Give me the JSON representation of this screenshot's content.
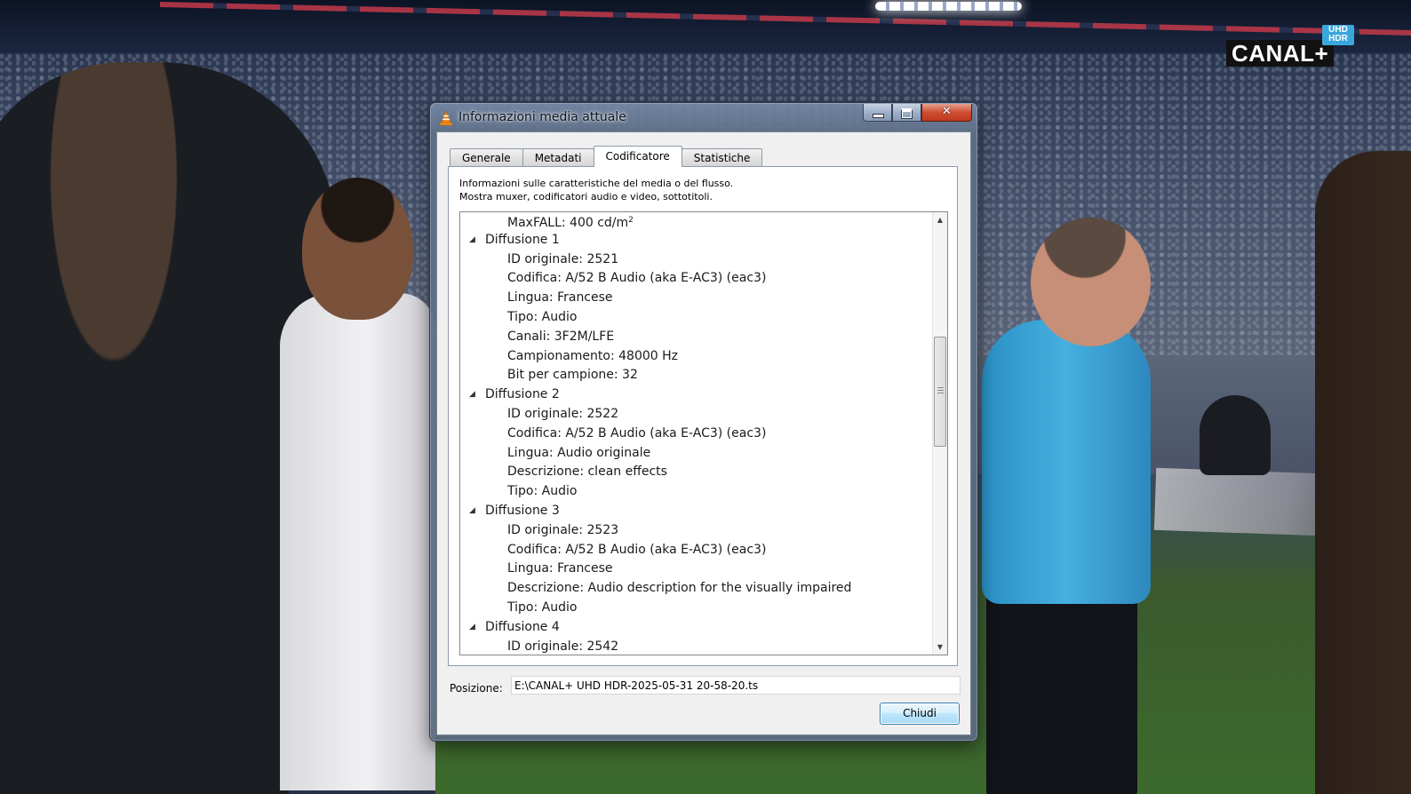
{
  "overlay": {
    "channel_logo": "CANAL+",
    "channel_tag": "UHD HDR"
  },
  "dialog": {
    "title": "Informazioni media attuale",
    "window_buttons": {
      "close_glyph": "✕"
    },
    "tabs": [
      {
        "label": "Generale",
        "active": false
      },
      {
        "label": "Metadati",
        "active": false
      },
      {
        "label": "Codificatore",
        "active": true
      },
      {
        "label": "Statistiche",
        "active": false
      }
    ],
    "description_line1": "Informazioni sulle caratteristiche del media o del flusso.",
    "description_line2": "Mostra muxer, codificatori audio e video, sottotitoli.",
    "tree": [
      {
        "level": 1,
        "text": "MaxFALL: 400 cd/m",
        "sup": "2"
      },
      {
        "level": 0,
        "text": "Diffusione 1"
      },
      {
        "level": 1,
        "text": "ID originale: 2521"
      },
      {
        "level": 1,
        "text": "Codifica: A/52 B Audio (aka E-AC3) (eac3)"
      },
      {
        "level": 1,
        "text": "Lingua: Francese"
      },
      {
        "level": 1,
        "text": "Tipo: Audio"
      },
      {
        "level": 1,
        "text": "Canali: 3F2M/LFE"
      },
      {
        "level": 1,
        "text": "Campionamento: 48000 Hz"
      },
      {
        "level": 1,
        "text": "Bit per campione: 32"
      },
      {
        "level": 0,
        "text": "Diffusione 2"
      },
      {
        "level": 1,
        "text": "ID originale: 2522"
      },
      {
        "level": 1,
        "text": "Codifica: A/52 B Audio (aka E-AC3) (eac3)"
      },
      {
        "level": 1,
        "text": "Lingua: Audio originale"
      },
      {
        "level": 1,
        "text": "Descrizione: clean effects"
      },
      {
        "level": 1,
        "text": "Tipo: Audio"
      },
      {
        "level": 0,
        "text": "Diffusione 3"
      },
      {
        "level": 1,
        "text": "ID originale: 2523"
      },
      {
        "level": 1,
        "text": "Codifica: A/52 B Audio (aka E-AC3) (eac3)"
      },
      {
        "level": 1,
        "text": "Lingua: Francese"
      },
      {
        "level": 1,
        "text": "Descrizione: Audio description for the visually impaired"
      },
      {
        "level": 1,
        "text": "Tipo: Audio"
      },
      {
        "level": 0,
        "text": "Diffusione 4"
      },
      {
        "level": 1,
        "text": "ID originale: 2542"
      }
    ],
    "expander_glyph": "◢",
    "scroll_up_glyph": "▲",
    "scroll_down_glyph": "▼",
    "position_label": "Posizione:",
    "position_value": "E:\\CANAL+ UHD HDR-2025-05-31 20-58-20.ts",
    "close_button": "Chiudi"
  },
  "colors": {
    "titlebar_close": "#c0381f",
    "vlc_orange": "#f08c1a",
    "channel_tag": "#3aa7dc"
  },
  "icons": {
    "app_icon": "vlc-cone-icon",
    "minimize": "minimize-icon",
    "maximize": "maximize-icon",
    "close": "close-icon",
    "expander": "tree-expander-icon",
    "scroll_up": "scroll-up-arrow-icon",
    "scroll_down": "scroll-down-arrow-icon"
  }
}
